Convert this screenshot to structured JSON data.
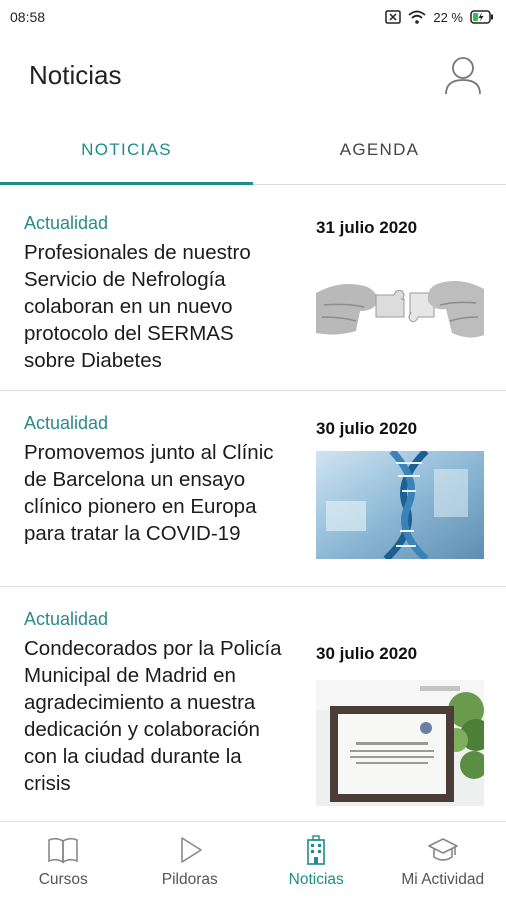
{
  "status": {
    "time": "08:58",
    "battery": "22 %"
  },
  "header": {
    "title": "Noticias"
  },
  "tabs": [
    {
      "label": "NOTICIAS",
      "active": true
    },
    {
      "label": "AGENDA",
      "active": false
    }
  ],
  "news": [
    {
      "category": "Actualidad",
      "title": "Profesionales de nuestro Servicio de Nefrología colaboran en un nuevo protocolo del SERMAS sobre Diabetes",
      "date": "31 julio 2020"
    },
    {
      "category": "Actualidad",
      "title": "Promovemos junto al Clínic de Barcelona un ensayo clínico pionero en Europa para tratar la COVID-19",
      "date": "30 julio 2020"
    },
    {
      "category": "Actualidad",
      "title": "Condecorados por la Policía Municipal de Madrid en agradecimiento a nuestra dedicación y colaboración con la ciudad durante la crisis",
      "date": "30 julio 2020"
    }
  ],
  "bottom_nav": [
    {
      "label": "Cursos",
      "icon": "book-icon",
      "active": false
    },
    {
      "label": "Pildoras",
      "icon": "play-icon",
      "active": false
    },
    {
      "label": "Noticias",
      "icon": "building-icon",
      "active": true
    },
    {
      "label": "Mi Actividad",
      "icon": "graduation-cap-icon",
      "active": false
    }
  ],
  "colors": {
    "accent": "#1f8b8b",
    "category": "#2b8a8a"
  }
}
